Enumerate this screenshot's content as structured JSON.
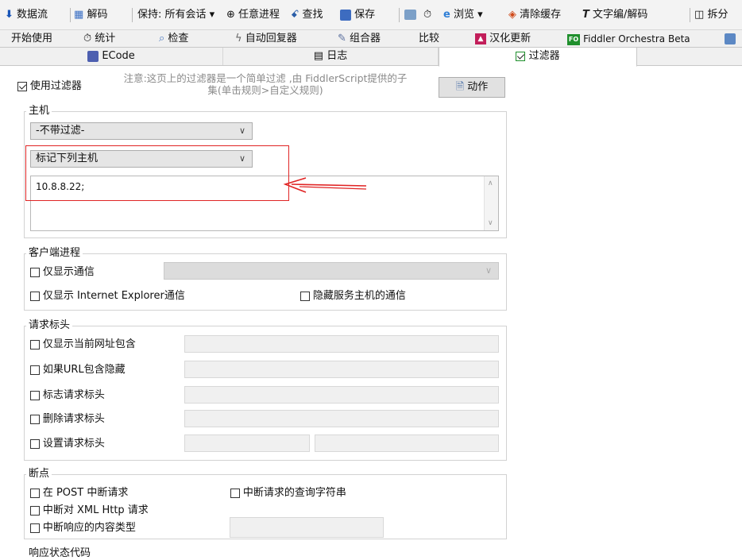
{
  "toolbar": {
    "stream": "数据流",
    "decode": "解码",
    "keep": "保持: 所有会话 ▾",
    "any_process": "任意进程",
    "find": "查找",
    "save": "保存",
    "browse": "浏览 ▾",
    "clear_cache": "清除缓存",
    "text_encode": "文字编/解码",
    "split": "拆分"
  },
  "tabs": [
    {
      "label": "开始使用"
    },
    {
      "label": "统计"
    },
    {
      "label": "检查"
    },
    {
      "label": "自动回复器"
    },
    {
      "label": "组合器"
    },
    {
      "label": "比较"
    },
    {
      "label": "汉化更新"
    },
    {
      "label": "Fiddler Orchestra Beta"
    }
  ],
  "subtabs": {
    "ecode": "ECode",
    "log": "日志",
    "filters": "过滤器"
  },
  "filters": {
    "use_filter": "使用过滤器",
    "note_line1": "注意:这页上的过滤器是一个简单过滤 ,由 FiddlerScript提供的子",
    "note_line2": "集(单击规则>自定义规则)",
    "action_button": "动作",
    "hosts": {
      "legend": "主机",
      "zone_select": "-不带过滤-",
      "host_mode_select": "标记下列主机",
      "host_list": "10.8.8.22;"
    },
    "client_process": {
      "legend": "客户端进程",
      "show_only_traffic": "仅显示通信",
      "show_only_ie": "仅显示 Internet Explorer通信",
      "hide_service_hosts": "隐藏服务主机的通信"
    },
    "request_headers": {
      "legend": "请求标头",
      "show_if_url_contains": "仅显示当前网址包含",
      "hide_if_url_contains": "如果URL包含隐藏",
      "flag_header": "标志请求标头",
      "delete_header": "删除请求标头",
      "set_header": "设置请求标头"
    },
    "breakpoints": {
      "legend": "断点",
      "break_on_post": "在 POST 中断请求",
      "break_on_querystring": "中断请求的查询字符串",
      "break_on_xmlhttp": "中断对 XML Http 请求",
      "break_on_content_type": "中断响应的内容类型"
    },
    "response_status": {
      "legend": "响应状态代码"
    }
  },
  "colors": {
    "annotation_red": "#e02424",
    "link_blue": "#1e5fbf"
  }
}
